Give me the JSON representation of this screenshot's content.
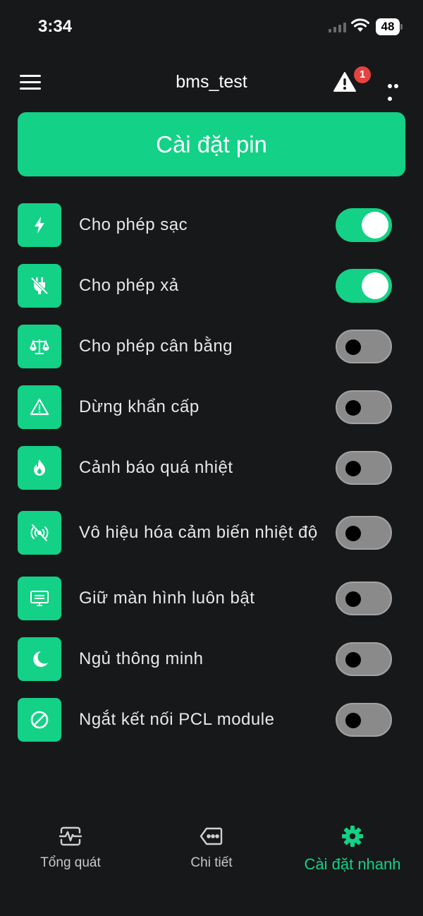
{
  "status_bar": {
    "time": "3:34",
    "battery_level": "48"
  },
  "header": {
    "title": "bms_test",
    "alert_count": "1"
  },
  "primary_button": {
    "label": "Cài đặt pin"
  },
  "settings": [
    {
      "label": "Cho phép sạc",
      "icon": "lightning-icon",
      "enabled": true
    },
    {
      "label": "Cho phép xả",
      "icon": "plug-off-icon",
      "enabled": true
    },
    {
      "label": "Cho phép cân bằng",
      "icon": "scale-icon",
      "enabled": false
    },
    {
      "label": "Dừng khẩn cấp",
      "icon": "warning-icon",
      "enabled": false
    },
    {
      "label": "Cảnh báo quá nhiệt",
      "icon": "fire-icon",
      "enabled": false
    },
    {
      "label": "Vô hiệu hóa cảm biến nhiệt độ",
      "icon": "sensor-off-icon",
      "enabled": false
    },
    {
      "label": "Giữ màn hình luôn bật",
      "icon": "monitor-icon",
      "enabled": false
    },
    {
      "label": "Ngủ thông minh",
      "icon": "moon-icon",
      "enabled": false
    },
    {
      "label": "Ngắt kết nối PCL module",
      "icon": "block-icon",
      "enabled": false
    }
  ],
  "bottom_nav": [
    {
      "label": "Tổng quát",
      "icon": "pulse-monitor-icon",
      "active": false
    },
    {
      "label": "Chi tiết",
      "icon": "tag-dots-icon",
      "active": false
    },
    {
      "label": "Cài đặt nhanh",
      "icon": "gear-icon",
      "active": true
    }
  ],
  "colors": {
    "accent": "#13d186",
    "background": "#17181a",
    "badge": "#e8423f"
  }
}
